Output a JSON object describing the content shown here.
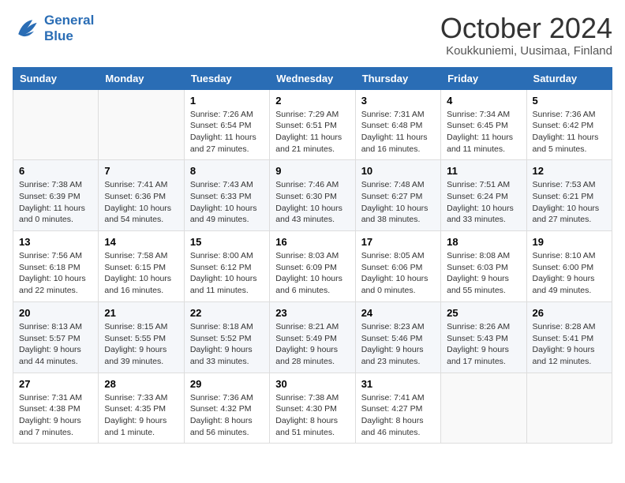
{
  "header": {
    "logo_line1": "General",
    "logo_line2": "Blue",
    "title": "October 2024",
    "subtitle": "Koukkuniemi, Uusimaa, Finland"
  },
  "days_of_week": [
    "Sunday",
    "Monday",
    "Tuesday",
    "Wednesday",
    "Thursday",
    "Friday",
    "Saturday"
  ],
  "weeks": [
    [
      {
        "day": "",
        "detail": ""
      },
      {
        "day": "",
        "detail": ""
      },
      {
        "day": "1",
        "detail": "Sunrise: 7:26 AM\nSunset: 6:54 PM\nDaylight: 11 hours and 27 minutes."
      },
      {
        "day": "2",
        "detail": "Sunrise: 7:29 AM\nSunset: 6:51 PM\nDaylight: 11 hours and 21 minutes."
      },
      {
        "day": "3",
        "detail": "Sunrise: 7:31 AM\nSunset: 6:48 PM\nDaylight: 11 hours and 16 minutes."
      },
      {
        "day": "4",
        "detail": "Sunrise: 7:34 AM\nSunset: 6:45 PM\nDaylight: 11 hours and 11 minutes."
      },
      {
        "day": "5",
        "detail": "Sunrise: 7:36 AM\nSunset: 6:42 PM\nDaylight: 11 hours and 5 minutes."
      }
    ],
    [
      {
        "day": "6",
        "detail": "Sunrise: 7:38 AM\nSunset: 6:39 PM\nDaylight: 11 hours and 0 minutes."
      },
      {
        "day": "7",
        "detail": "Sunrise: 7:41 AM\nSunset: 6:36 PM\nDaylight: 10 hours and 54 minutes."
      },
      {
        "day": "8",
        "detail": "Sunrise: 7:43 AM\nSunset: 6:33 PM\nDaylight: 10 hours and 49 minutes."
      },
      {
        "day": "9",
        "detail": "Sunrise: 7:46 AM\nSunset: 6:30 PM\nDaylight: 10 hours and 43 minutes."
      },
      {
        "day": "10",
        "detail": "Sunrise: 7:48 AM\nSunset: 6:27 PM\nDaylight: 10 hours and 38 minutes."
      },
      {
        "day": "11",
        "detail": "Sunrise: 7:51 AM\nSunset: 6:24 PM\nDaylight: 10 hours and 33 minutes."
      },
      {
        "day": "12",
        "detail": "Sunrise: 7:53 AM\nSunset: 6:21 PM\nDaylight: 10 hours and 27 minutes."
      }
    ],
    [
      {
        "day": "13",
        "detail": "Sunrise: 7:56 AM\nSunset: 6:18 PM\nDaylight: 10 hours and 22 minutes."
      },
      {
        "day": "14",
        "detail": "Sunrise: 7:58 AM\nSunset: 6:15 PM\nDaylight: 10 hours and 16 minutes."
      },
      {
        "day": "15",
        "detail": "Sunrise: 8:00 AM\nSunset: 6:12 PM\nDaylight: 10 hours and 11 minutes."
      },
      {
        "day": "16",
        "detail": "Sunrise: 8:03 AM\nSunset: 6:09 PM\nDaylight: 10 hours and 6 minutes."
      },
      {
        "day": "17",
        "detail": "Sunrise: 8:05 AM\nSunset: 6:06 PM\nDaylight: 10 hours and 0 minutes."
      },
      {
        "day": "18",
        "detail": "Sunrise: 8:08 AM\nSunset: 6:03 PM\nDaylight: 9 hours and 55 minutes."
      },
      {
        "day": "19",
        "detail": "Sunrise: 8:10 AM\nSunset: 6:00 PM\nDaylight: 9 hours and 49 minutes."
      }
    ],
    [
      {
        "day": "20",
        "detail": "Sunrise: 8:13 AM\nSunset: 5:57 PM\nDaylight: 9 hours and 44 minutes."
      },
      {
        "day": "21",
        "detail": "Sunrise: 8:15 AM\nSunset: 5:55 PM\nDaylight: 9 hours and 39 minutes."
      },
      {
        "day": "22",
        "detail": "Sunrise: 8:18 AM\nSunset: 5:52 PM\nDaylight: 9 hours and 33 minutes."
      },
      {
        "day": "23",
        "detail": "Sunrise: 8:21 AM\nSunset: 5:49 PM\nDaylight: 9 hours and 28 minutes."
      },
      {
        "day": "24",
        "detail": "Sunrise: 8:23 AM\nSunset: 5:46 PM\nDaylight: 9 hours and 23 minutes."
      },
      {
        "day": "25",
        "detail": "Sunrise: 8:26 AM\nSunset: 5:43 PM\nDaylight: 9 hours and 17 minutes."
      },
      {
        "day": "26",
        "detail": "Sunrise: 8:28 AM\nSunset: 5:41 PM\nDaylight: 9 hours and 12 minutes."
      }
    ],
    [
      {
        "day": "27",
        "detail": "Sunrise: 7:31 AM\nSunset: 4:38 PM\nDaylight: 9 hours and 7 minutes."
      },
      {
        "day": "28",
        "detail": "Sunrise: 7:33 AM\nSunset: 4:35 PM\nDaylight: 9 hours and 1 minute."
      },
      {
        "day": "29",
        "detail": "Sunrise: 7:36 AM\nSunset: 4:32 PM\nDaylight: 8 hours and 56 minutes."
      },
      {
        "day": "30",
        "detail": "Sunrise: 7:38 AM\nSunset: 4:30 PM\nDaylight: 8 hours and 51 minutes."
      },
      {
        "day": "31",
        "detail": "Sunrise: 7:41 AM\nSunset: 4:27 PM\nDaylight: 8 hours and 46 minutes."
      },
      {
        "day": "",
        "detail": ""
      },
      {
        "day": "",
        "detail": ""
      }
    ]
  ]
}
